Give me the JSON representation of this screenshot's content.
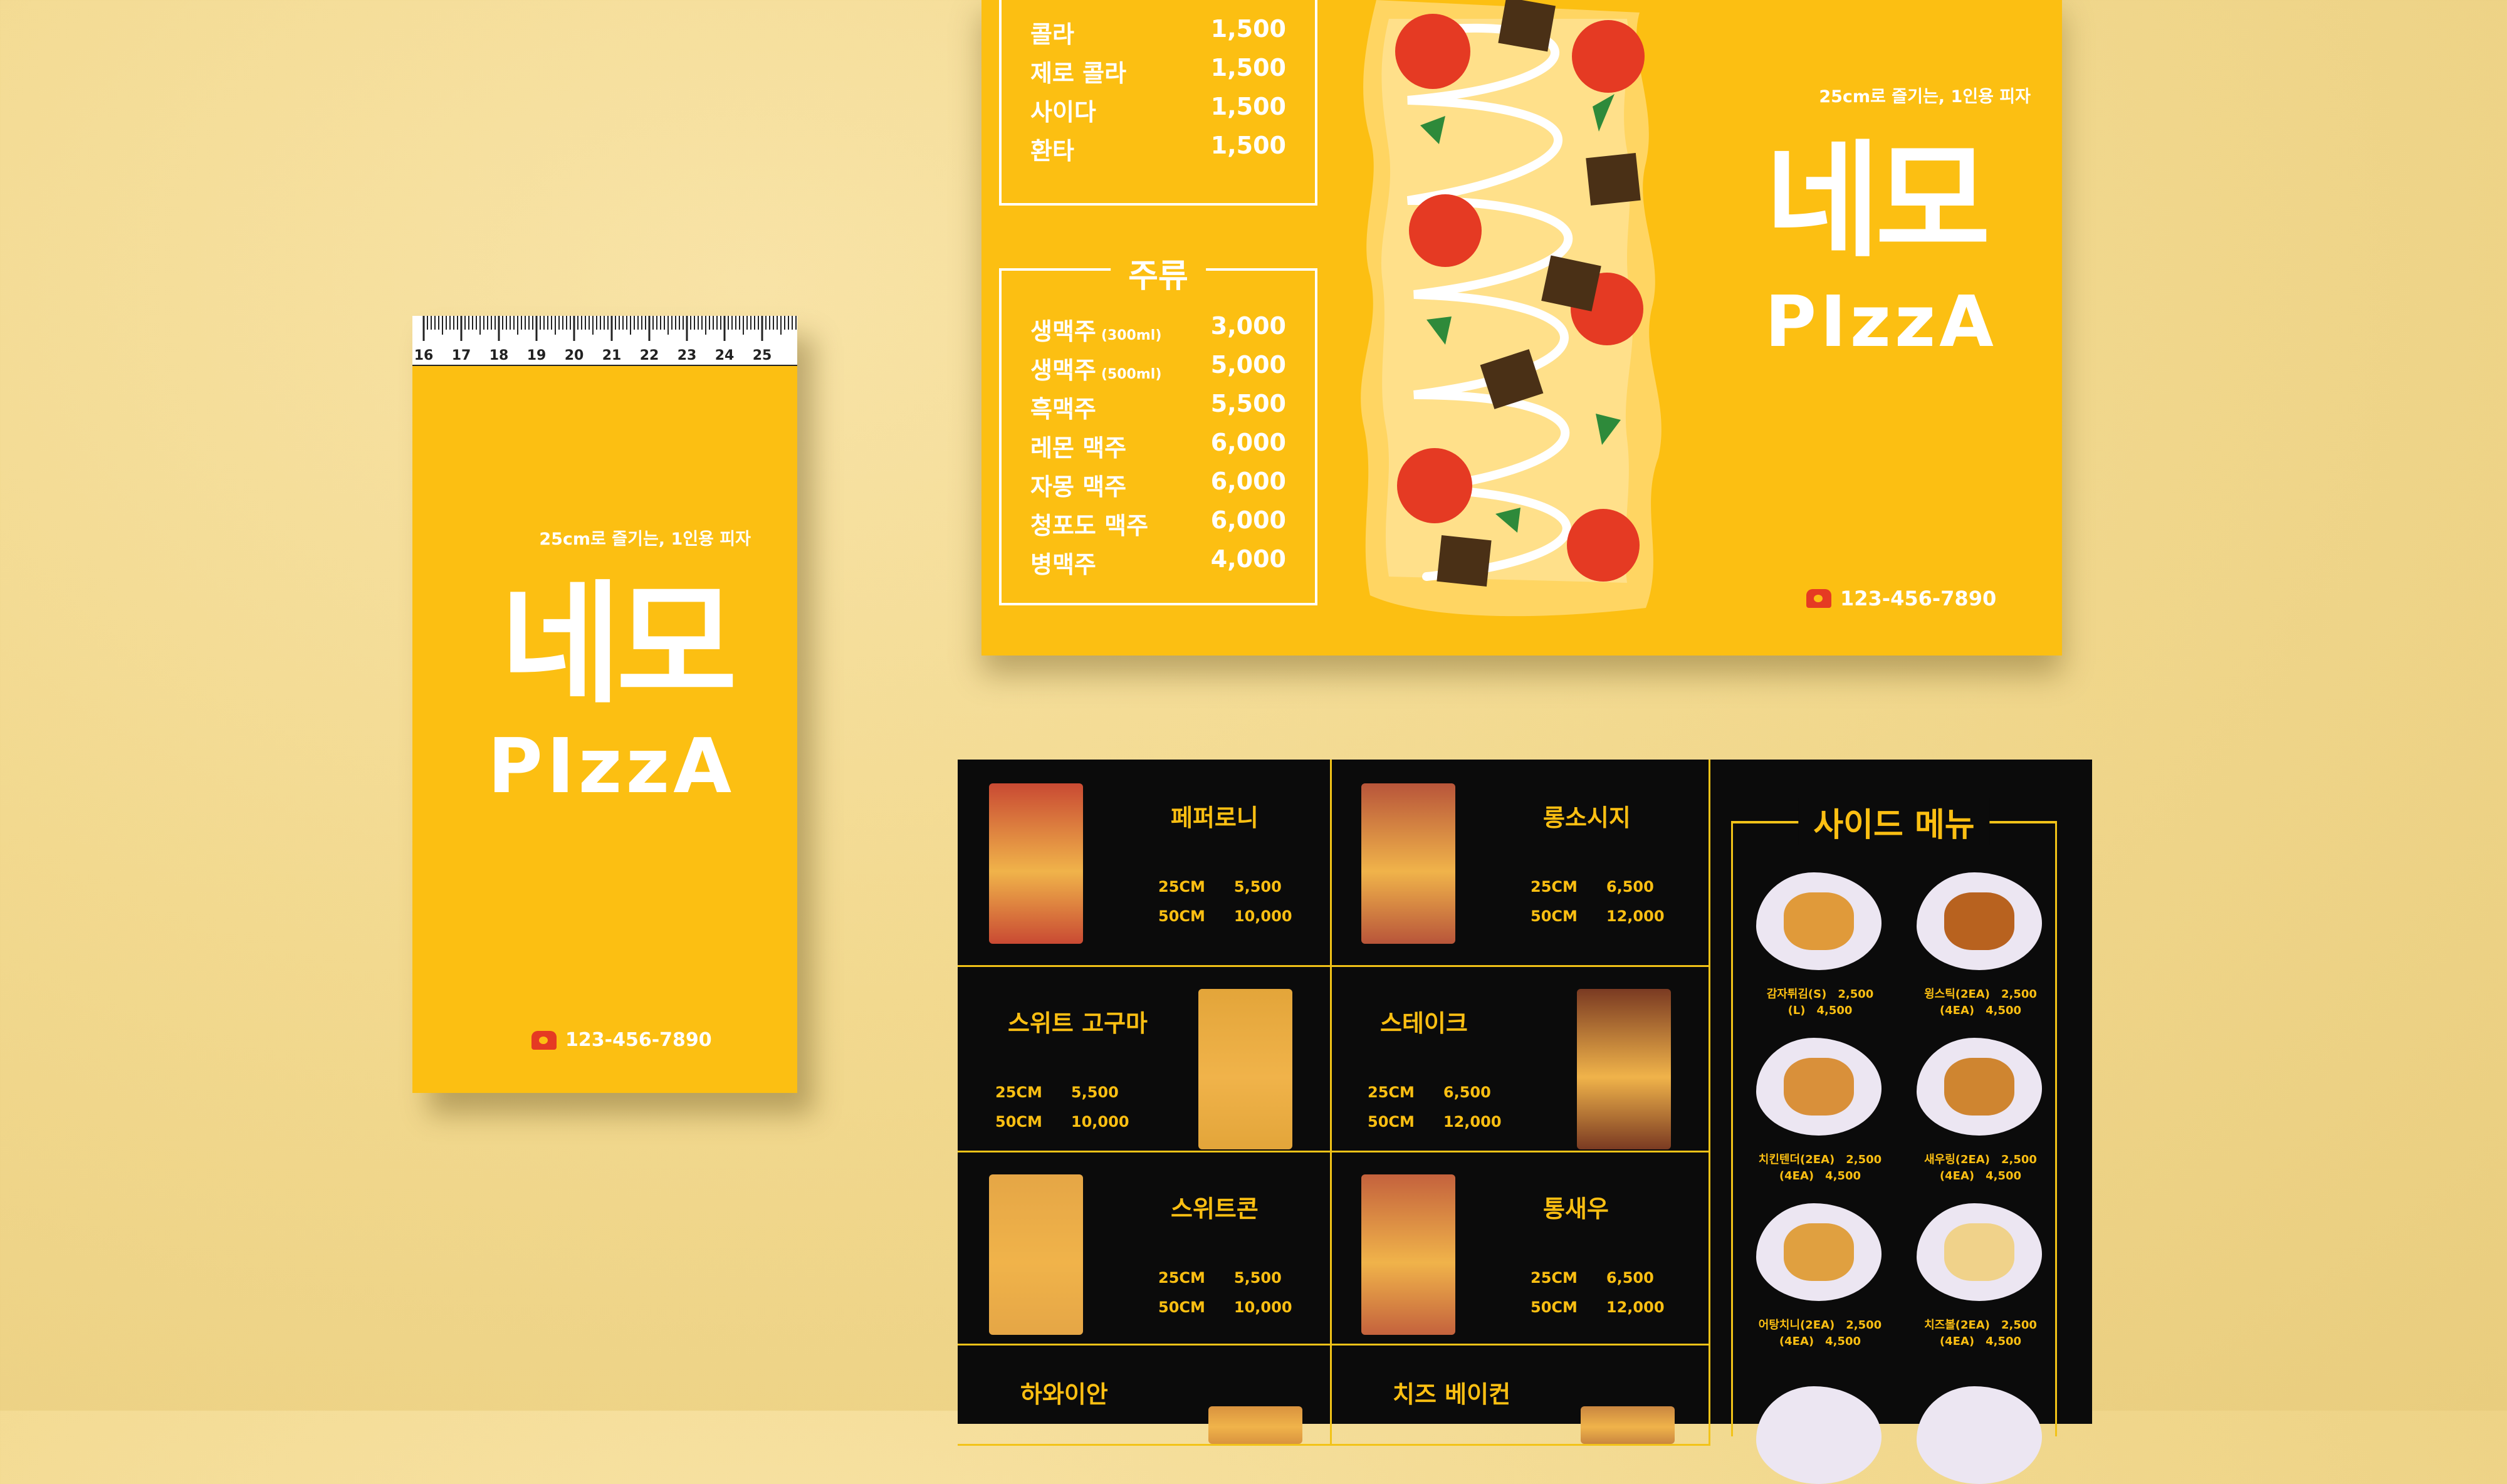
{
  "card": {
    "ruler_numbers": [
      "16",
      "17",
      "18",
      "19",
      "20",
      "21",
      "22",
      "23",
      "24",
      "25"
    ],
    "tagline": "25cm로 즐기는, 1인용 피자",
    "brand_korean": "네모",
    "brand_latin": "PIzzA",
    "phone": "123-456-7890"
  },
  "flyer": {
    "soft_drinks": [
      {
        "name": "콜라",
        "price": "1,500"
      },
      {
        "name": "제로 콜라",
        "price": "1,500"
      },
      {
        "name": "사이다",
        "price": "1,500"
      },
      {
        "name": "환타",
        "price": "1,500"
      }
    ],
    "alcohol_title": "주류",
    "alcohol": [
      {
        "name": "생맥주",
        "note": "(300ml)",
        "price": "3,000"
      },
      {
        "name": "생맥주",
        "note": "(500ml)",
        "price": "5,000"
      },
      {
        "name": "흑맥주",
        "note": "",
        "price": "5,500"
      },
      {
        "name": "레몬 맥주",
        "note": "",
        "price": "6,000"
      },
      {
        "name": "자몽 맥주",
        "note": "",
        "price": "6,000"
      },
      {
        "name": "청포도 맥주",
        "note": "",
        "price": "6,000"
      },
      {
        "name": "병맥주",
        "note": "",
        "price": "4,000"
      }
    ],
    "tagline": "25cm로 즐기는, 1인용 피자",
    "brand_korean": "네모",
    "brand_latin": "PIzzA",
    "phone": "123-456-7890"
  },
  "menu": {
    "pizzas": [
      {
        "name": "페퍼로니",
        "s_label": "25CM",
        "s_price": "5,500",
        "l_label": "50CM",
        "l_price": "10,000",
        "color": "#c94a33"
      },
      {
        "name": "롱소시지",
        "s_label": "25CM",
        "s_price": "6,500",
        "l_label": "50CM",
        "l_price": "12,000",
        "color": "#b8553a"
      },
      {
        "name": "스위트 고구마",
        "s_label": "25CM",
        "s_price": "5,500",
        "l_label": "50CM",
        "l_price": "10,000",
        "color": "#e3a53a"
      },
      {
        "name": "스테이크",
        "s_label": "25CM",
        "s_price": "6,500",
        "l_label": "50CM",
        "l_price": "12,000",
        "color": "#7a3a22"
      },
      {
        "name": "스위트콘",
        "s_label": "25CM",
        "s_price": "5,500",
        "l_label": "50CM",
        "l_price": "10,000",
        "color": "#e5a646"
      },
      {
        "name": "통새우",
        "s_label": "25CM",
        "s_price": "6,500",
        "l_label": "50CM",
        "l_price": "12,000",
        "color": "#c4623d"
      },
      {
        "name": "하와이안",
        "color": "#d9933f"
      },
      {
        "name": "치즈 베이컨",
        "color": "#c98640"
      }
    ],
    "side_title": "사이드 메뉴",
    "sides": [
      {
        "line1_name": "감자튀김(S)",
        "line1_price": "2,500",
        "line2_name": "(L)",
        "line2_price": "4,500",
        "food_color": "#e09a3a"
      },
      {
        "line1_name": "윙스틱(2EA)",
        "line1_price": "2,500",
        "line2_name": "(4EA)",
        "line2_price": "4,500",
        "food_color": "#b8621f"
      },
      {
        "line1_name": "치킨텐더(2EA)",
        "line1_price": "2,500",
        "line2_name": "(4EA)",
        "line2_price": "4,500",
        "food_color": "#d9903a"
      },
      {
        "line1_name": "새우링(2EA)",
        "line1_price": "2,500",
        "line2_name": "(4EA)",
        "line2_price": "4,500",
        "food_color": "#cf8530"
      },
      {
        "line1_name": "어탕치니(2EA)",
        "line1_price": "2,500",
        "line2_name": "(4EA)",
        "line2_price": "4,500",
        "food_color": "#e0a040"
      },
      {
        "line1_name": "치즈볼(2EA)",
        "line1_price": "2,500",
        "line2_name": "(4EA)",
        "line2_price": "4,500",
        "food_color": "#f0d28a"
      }
    ]
  },
  "colors": {
    "brand_yellow": "#fcbf12",
    "menu_black": "#0b0b0b",
    "accent_red": "#e53a23"
  }
}
